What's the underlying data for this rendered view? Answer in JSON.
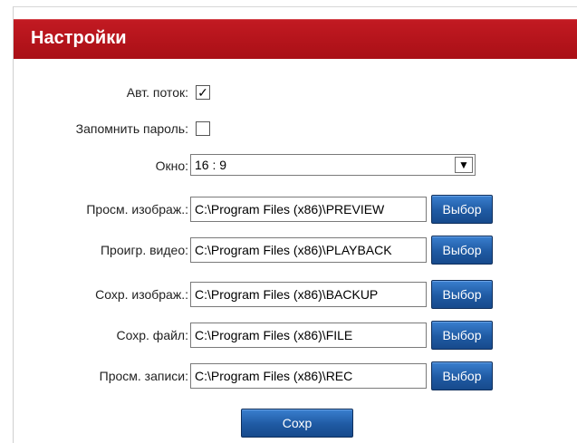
{
  "header": {
    "title": "Настройки"
  },
  "settings": {
    "auto_stream": {
      "label": "Авт. поток:",
      "checked": true
    },
    "remember_password": {
      "label": "Запомнить пароль:",
      "checked": false
    },
    "window": {
      "label": "Окно:",
      "value": "16 : 9"
    }
  },
  "paths": [
    {
      "label": "Просм. изображ.:",
      "value": "C:\\Program Files (x86)\\PREVIEW",
      "button": "Выбор"
    },
    {
      "label": "Проигр. видео:",
      "value": "C:\\Program Files (x86)\\PLAYBACK",
      "button": "Выбор"
    },
    {
      "label": "Сохр. изображ.:",
      "value": "C:\\Program Files (x86)\\BACKUP",
      "button": "Выбор"
    },
    {
      "label": "Сохр. файл:",
      "value": "C:\\Program Files (x86)\\FILE",
      "button": "Выбор"
    },
    {
      "label": "Просм. записи:",
      "value": "C:\\Program Files (x86)\\REC",
      "button": "Выбор"
    }
  ],
  "save_button": "Сохр",
  "colors": {
    "header": "#b5141b",
    "button": "#1f5aa3"
  }
}
